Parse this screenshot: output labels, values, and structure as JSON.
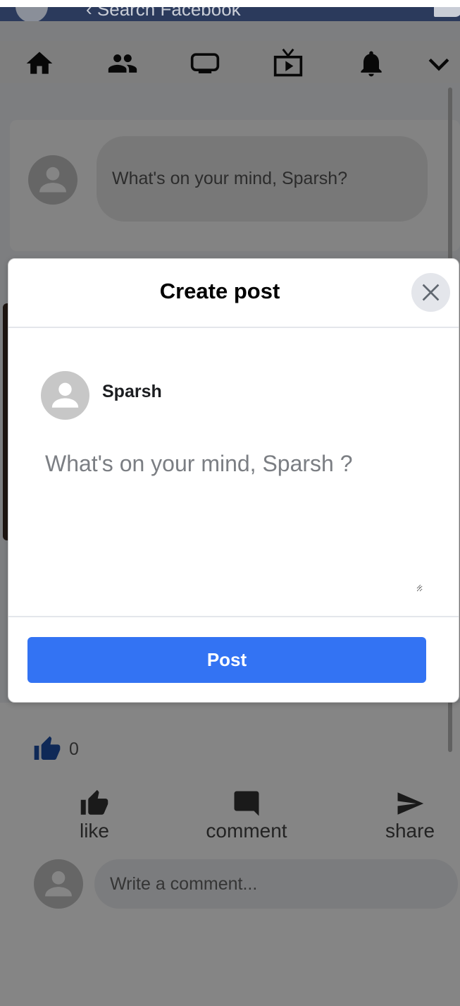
{
  "top_bar": {
    "search_placeholder": "Search Facebook"
  },
  "nav": {
    "items": [
      {
        "name": "home",
        "icon": "home-icon"
      },
      {
        "name": "friends",
        "icon": "friends-icon"
      },
      {
        "name": "watch",
        "icon": "tv-icon"
      },
      {
        "name": "live",
        "icon": "live-video-icon"
      },
      {
        "name": "notifications",
        "icon": "bell-icon"
      },
      {
        "name": "menu",
        "icon": "chevron-down-icon"
      }
    ]
  },
  "composer": {
    "placeholder": "What's on your mind, Sparsh?"
  },
  "post": {
    "like_count": "0",
    "actions": [
      {
        "label": "like",
        "icon": "like-icon"
      },
      {
        "label": "comment",
        "icon": "comment-icon"
      },
      {
        "label": "share",
        "icon": "share-icon"
      }
    ],
    "comment_placeholder": "Write a comment..."
  },
  "modal": {
    "title": "Create post",
    "user_name": "Sparsh",
    "textarea_placeholder": "What's on your mind, Sparsh ?",
    "post_button": "Post"
  },
  "colors": {
    "accent": "#3373f3",
    "like_blue": "#1d4fa8",
    "overlay": "rgba(0,0,0,0.48)"
  }
}
